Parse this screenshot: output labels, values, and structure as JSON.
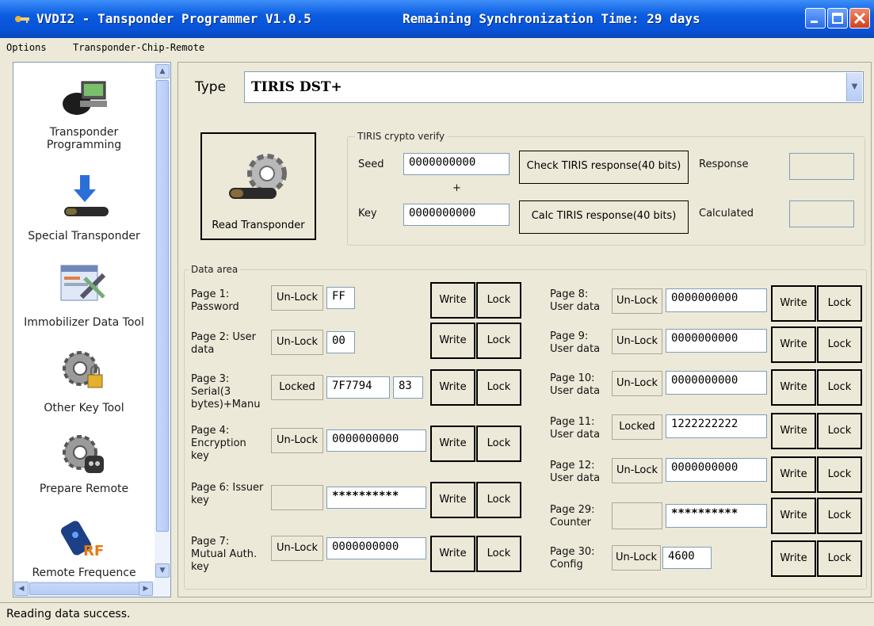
{
  "window": {
    "title": "VVDI2 - Tansponder Programmer V1.0.5",
    "remaining": "Remaining Synchronization Time: 29 days"
  },
  "menu": [
    "Options",
    "Transponder-Chip-Remote"
  ],
  "sidebar": {
    "items": [
      {
        "label": "Transponder Programming",
        "icon": "key-computer-icon"
      },
      {
        "label": "Special Transponder",
        "icon": "transponder-arrow-icon"
      },
      {
        "label": "Immobilizer Data Tool",
        "icon": "tools-window-icon"
      },
      {
        "label": "Other Key Tool",
        "icon": "gear-lock-icon"
      },
      {
        "label": "Prepare Remote",
        "icon": "gear-remote-icon"
      },
      {
        "label": "Remote Frequence",
        "icon": "rf-remote-icon"
      }
    ]
  },
  "type": {
    "label": "Type",
    "value": "TIRIS DST+"
  },
  "read_button": "Read Transponder",
  "crypto": {
    "title": "TIRIS crypto verify",
    "seed_label": "Seed",
    "seed_value": "0000000000",
    "plus": "+",
    "key_label": "Key",
    "key_value": "0000000000",
    "check_button": "Check TIRIS response(40 bits)",
    "calc_button": "Calc TIRIS response(40 bits)",
    "response_label": "Response",
    "calculated_label": "Calculated",
    "response_value": "",
    "calculated_value": ""
  },
  "data_area": {
    "title": "Data area",
    "write": "Write",
    "lock": "Lock",
    "left": [
      {
        "label": "Page 1: Password",
        "status": "Un-Lock",
        "value": "FF"
      },
      {
        "label": "Page 2: User data",
        "status": "Un-Lock",
        "value": "00"
      },
      {
        "label": "Page 3: Serial(3 bytes)+Manu",
        "status": "Locked",
        "value": "7F7794",
        "extra": "83"
      },
      {
        "label": "Page 4: Encryption key",
        "status": "Un-Lock",
        "value": "0000000000"
      },
      {
        "label": "Page 6: Issuer key",
        "status": "",
        "value": "**********"
      },
      {
        "label": "Page 7: Mutual Auth. key",
        "status": "Un-Lock",
        "value": "0000000000"
      }
    ],
    "right": [
      {
        "label": "Page 8: User data",
        "status": "Un-Lock",
        "value": "0000000000"
      },
      {
        "label": "Page 9: User data",
        "status": "Un-Lock",
        "value": "0000000000"
      },
      {
        "label": "Page 10: User data",
        "status": "Un-Lock",
        "value": "0000000000"
      },
      {
        "label": "Page 11: User data",
        "status": "Locked",
        "value": "1222222222"
      },
      {
        "label": "Page 12: User data",
        "status": "Un-Lock",
        "value": "0000000000"
      },
      {
        "label": "Page 29: Counter",
        "status": "",
        "value": "**********"
      },
      {
        "label": "Page 30: Config",
        "status": "Un-Lock",
        "value": "4600"
      }
    ]
  },
  "status": "Reading data success."
}
